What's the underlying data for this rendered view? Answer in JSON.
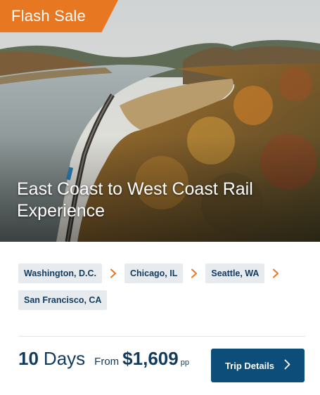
{
  "badge": {
    "label": "Flash Sale",
    "color": "#e87722"
  },
  "hero": {
    "title": "East Coast to West Coast Rail Experience",
    "image_subject": "aerial autumn river valley with railway along the shore"
  },
  "route": {
    "stops": [
      {
        "label": "Washington, D.C."
      },
      {
        "label": "Chicago, IL"
      },
      {
        "label": "Seattle, WA"
      },
      {
        "label": "San Francisco, CA"
      }
    ],
    "arrow_icon": "chevron-right-icon",
    "arrow_color": "#e87722"
  },
  "trip": {
    "days_number": "10",
    "days_label": "Days",
    "from_label": "From",
    "price": "$1,609",
    "price_unit": "pp"
  },
  "cta": {
    "label": "Trip Details",
    "icon": "chevron-right-icon",
    "color": "#0c4d7a"
  },
  "colors": {
    "text_dark": "#123a5c",
    "chip_bg": "#e8ebee"
  }
}
